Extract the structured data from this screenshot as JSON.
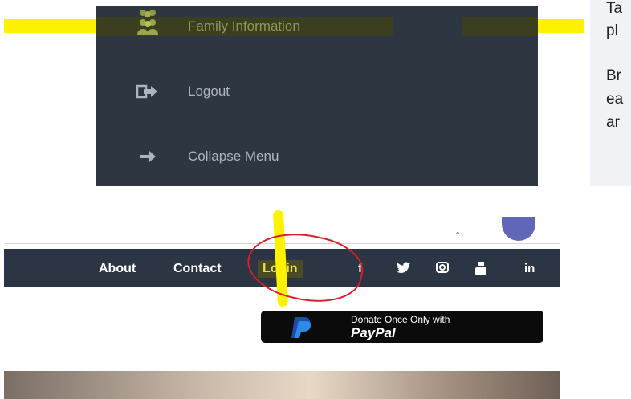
{
  "sidebar": {
    "items": [
      {
        "label": "Family Information",
        "icon": "users-icon"
      },
      {
        "label": "Logout",
        "icon": "logout-icon"
      },
      {
        "label": "Collapse Menu",
        "icon": "arrow-right-icon"
      }
    ]
  },
  "right_card": {
    "lines": [
      "Ta",
      "pl",
      "Br",
      "ea",
      "ar"
    ]
  },
  "navbar": {
    "links": [
      "About",
      "Contact",
      "Login"
    ],
    "social": [
      {
        "label": "f",
        "icon": "facebook-icon"
      },
      {
        "label": "🐦",
        "icon": "twitter-icon"
      },
      {
        "label": "◙",
        "icon": "instagram-icon"
      },
      {
        "label": "▶",
        "icon": "youtube-icon"
      },
      {
        "label": "in",
        "icon": "linkedin-icon"
      }
    ]
  },
  "paypal": {
    "top_text": "Donate Once Only with",
    "brand": "PayPal"
  },
  "colors": {
    "sidebar_bg": "#2e3642",
    "navbar_bg": "#2c3543",
    "highlight": "#fff200",
    "annotation": "#d51f2a"
  }
}
